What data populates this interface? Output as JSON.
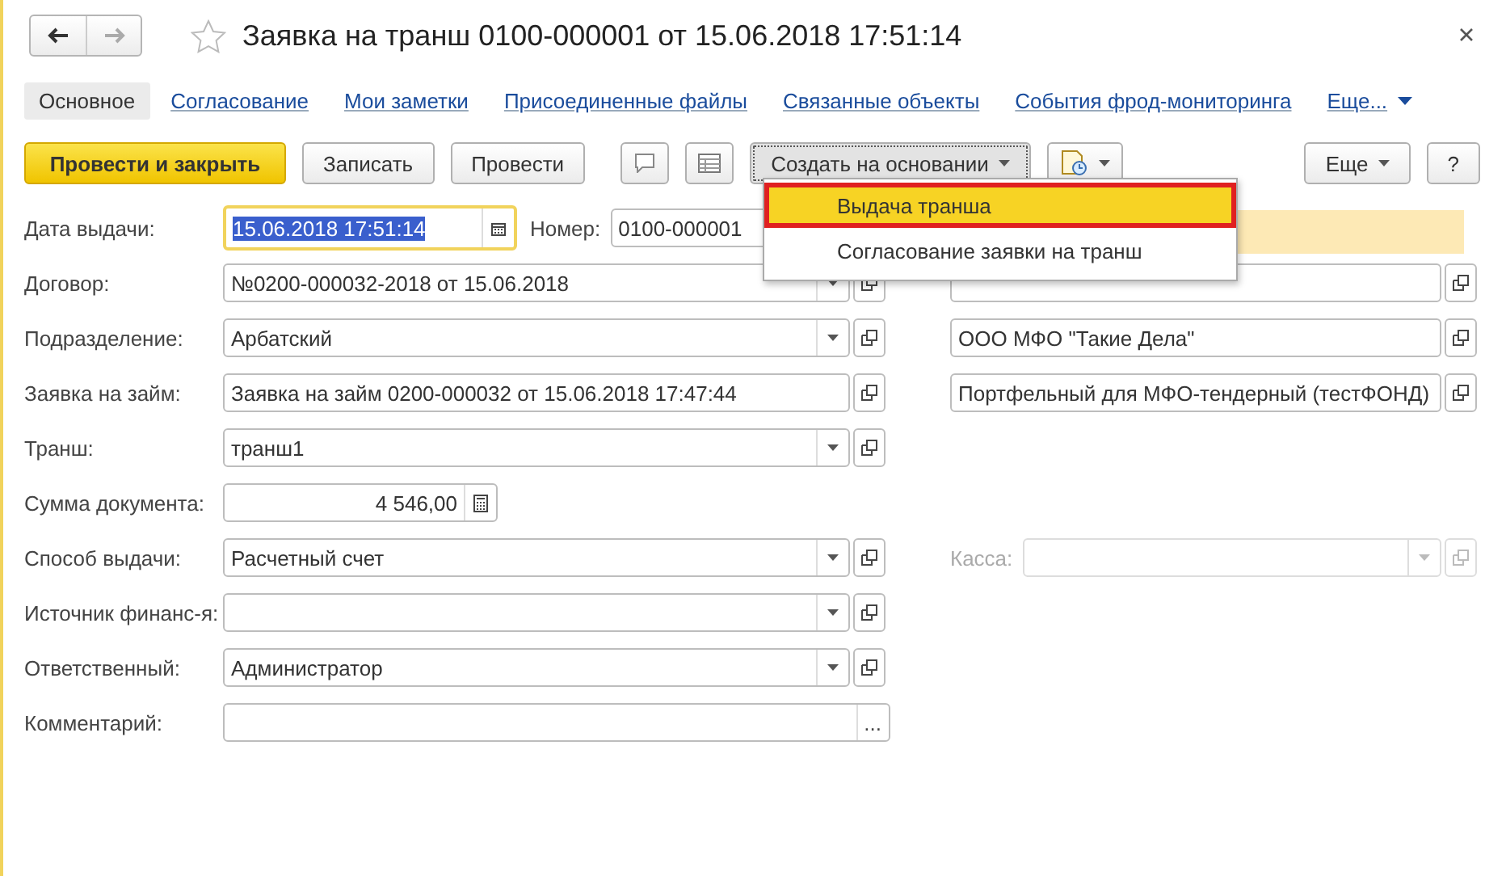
{
  "window": {
    "title": "Заявка на транш 0100-000001 от 15.06.2018 17:51:14",
    "favorite": false
  },
  "tabs": [
    {
      "label": "Основное",
      "selected": true
    },
    {
      "label": "Согласование",
      "selected": false
    },
    {
      "label": "Мои заметки",
      "selected": false
    },
    {
      "label": "Присоединенные файлы",
      "selected": false
    },
    {
      "label": "Связанные объекты",
      "selected": false
    },
    {
      "label": "События фрод-мониторинга",
      "selected": false
    },
    {
      "label": "Еще...",
      "selected": false,
      "kind": "more"
    }
  ],
  "toolbar": {
    "left": [
      {
        "kind": "primary",
        "label": "Провести и закрыть"
      },
      {
        "kind": "normal",
        "label": "Записать"
      },
      {
        "kind": "normal",
        "label": "Провести"
      },
      {
        "kind": "comment"
      },
      {
        "kind": "table"
      },
      {
        "kind": "menu",
        "label": "Создать на основании",
        "open": true
      },
      {
        "kind": "report"
      }
    ],
    "right": [
      {
        "kind": "menu",
        "label": "Еще",
        "open": false
      },
      {
        "kind": "normal",
        "label": "?"
      }
    ]
  },
  "menu": {
    "items": [
      {
        "label": "Выдача транша",
        "selected": true
      },
      {
        "label": "Согласование заявки на транш",
        "selected": false
      }
    ]
  },
  "rows": [
    {
      "label": "Дата выдачи:",
      "left": {
        "kind": "date",
        "value": "15.06.2018 17:51:14",
        "focused": true,
        "text_selected": true
      },
      "number": {
        "label": "Номер:",
        "value": "0100-000001"
      },
      "right": {
        "kind": "band"
      }
    },
    {
      "label": "Договор:",
      "left": {
        "kind": "choice",
        "value": "№0200-000032-2018 от 15.06.2018"
      },
      "right": {
        "kind": "ref"
      }
    },
    {
      "label": "Подразделение:",
      "left": {
        "kind": "choice",
        "value": "Арбатский"
      },
      "right": {
        "kind": "ref",
        "value": "ООО МФО \"Такие Дела\""
      }
    },
    {
      "label": "Заявка на займ:",
      "left": {
        "kind": "ref",
        "value": "Заявка на займ 0200-000032 от 15.06.2018 17:47:44"
      },
      "right": {
        "kind": "ref",
        "value": "Портфельный для МФО-тендерный (тестФОНД)"
      }
    },
    {
      "label": "Транш:",
      "left": {
        "kind": "choice",
        "value": "транш1"
      }
    },
    {
      "label": "Сумма документа:",
      "left": {
        "kind": "amount",
        "value": "4 546,00"
      }
    },
    {
      "label": "Способ выдачи:",
      "left": {
        "kind": "choice",
        "value": "Расчетный счет"
      },
      "right": {
        "kind": "choice",
        "label": "Касса:",
        "disabled": true
      }
    },
    {
      "label": "Источник финанс-я:",
      "left": {
        "kind": "choice"
      }
    },
    {
      "label": "Ответственный:",
      "left": {
        "kind": "choice",
        "value": "Администратор"
      }
    },
    {
      "label": "Комментарий:",
      "left": {
        "kind": "text",
        "button_text": "..."
      }
    }
  ]
}
